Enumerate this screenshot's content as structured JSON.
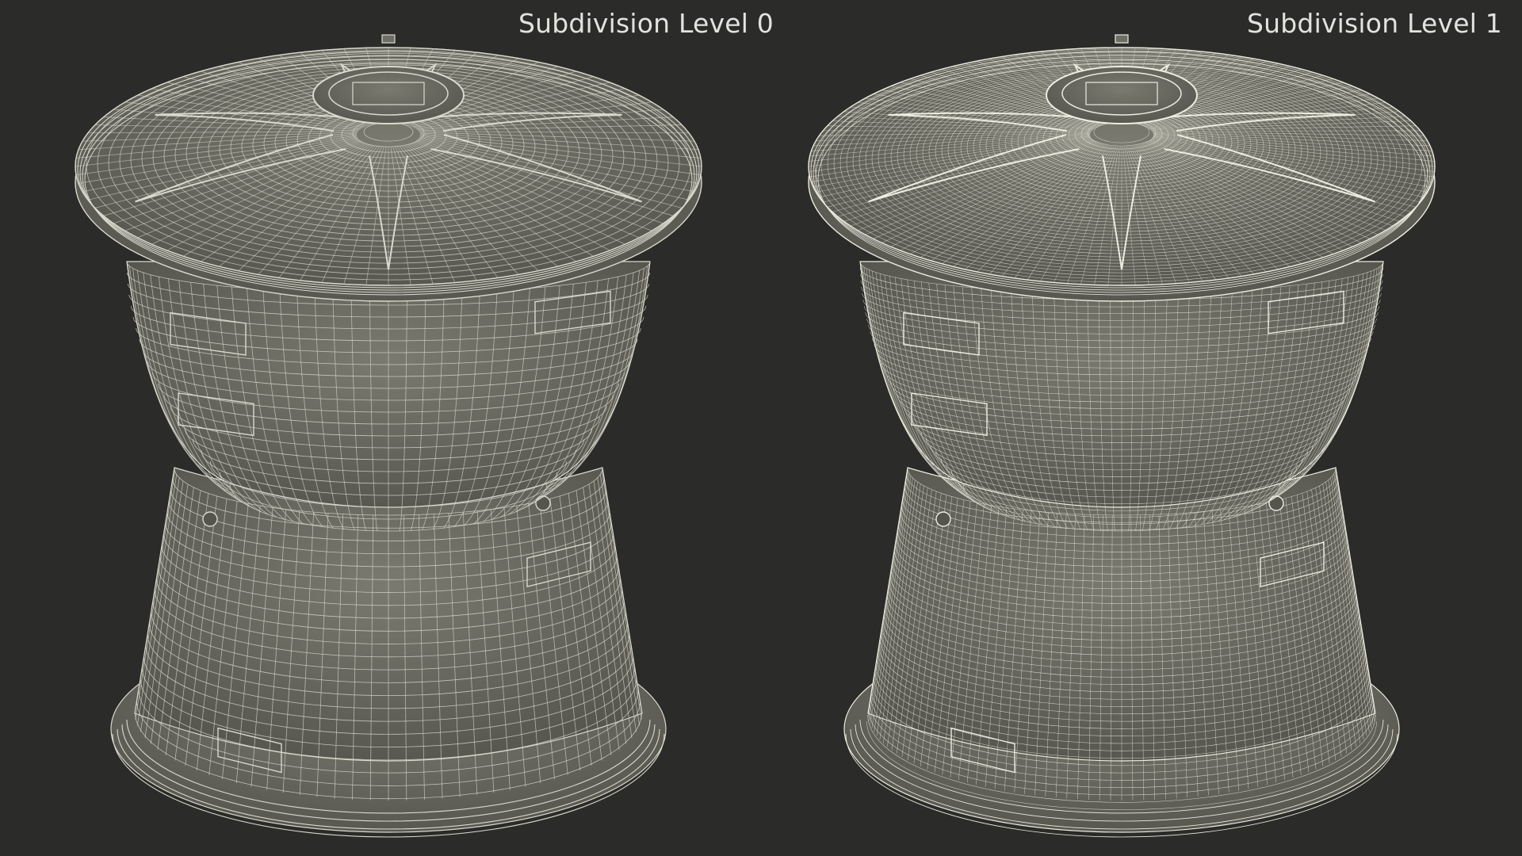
{
  "labels": {
    "left": "Subdivision Level 0",
    "right": "Subdivision Level 1"
  },
  "colors": {
    "background": "#2b2b2a",
    "surface": "#6e6e65",
    "surface_dark": "#55554e",
    "wire": "#d9d9cd",
    "wire_dense": "#ececdf",
    "label": "#e2e2de"
  },
  "models": {
    "left": {
      "subdivision_level": 0
    },
    "right": {
      "subdivision_level": 1
    }
  }
}
